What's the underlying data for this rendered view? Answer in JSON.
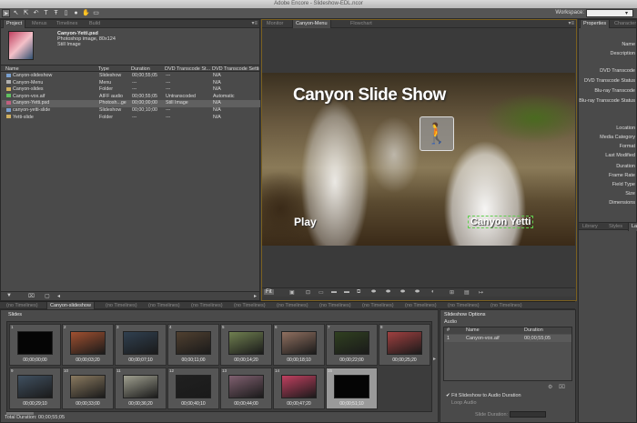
{
  "app": {
    "title": "Adobe Encore - Slideshow-EDL.ncor",
    "workspace_label": "Workspace:"
  },
  "tools": [
    "arrow-tool",
    "direct-select-tool",
    "move-tool",
    "rotate-tool",
    "text-tool",
    "vertical-text-tool",
    "edge-tool",
    "zoom-tool",
    "preview-tool"
  ],
  "project_panel": {
    "tabs": [
      "Project",
      "Menus",
      "Timelines",
      "Build"
    ],
    "selected_file": {
      "name": "Canyon-Yetti.psd",
      "type": "Photoshop image, 80x124",
      "kind": "Still Image"
    },
    "columns": [
      "Name",
      "Type",
      "Duration",
      "DVD Transcode St...",
      "DVD Transcode Settin"
    ],
    "items": [
      {
        "name": "Canyon-slideshow",
        "type": "Slideshow",
        "duration": "00;00;55;05",
        "status": "---",
        "settings": "N/A",
        "icon_color": "#7aa0d0",
        "selected": false
      },
      {
        "name": "Canyon-Menu",
        "type": "Menu",
        "duration": "---",
        "status": "---",
        "settings": "N/A",
        "icon_color": "#b0b0b0",
        "selected": false
      },
      {
        "name": "Canyon-slides",
        "type": "Folder",
        "duration": "---",
        "status": "---",
        "settings": "N/A",
        "icon_color": "#d0b060",
        "selected": false
      },
      {
        "name": "Canyon-vox.aif",
        "type": "AIFF audio",
        "duration": "00;00;55;05",
        "status": "Untranscoded",
        "settings": "Automatic",
        "icon_color": "#60c060",
        "selected": false
      },
      {
        "name": "Canyon-Yetti.psd",
        "type": "Photosh...ge",
        "duration": "00;00;00;00",
        "status": "Still Image",
        "settings": "N/A",
        "icon_color": "#c06080",
        "selected": true
      },
      {
        "name": "canyon-yetti-slide",
        "type": "Slideshow",
        "duration": "00;00;10;00",
        "status": "---",
        "settings": "N/A",
        "icon_color": "#7aa0d0",
        "selected": false
      },
      {
        "name": "Yetti-slide",
        "type": "Folder",
        "duration": "---",
        "status": "---",
        "settings": "N/A",
        "icon_color": "#d0b060",
        "selected": false
      }
    ]
  },
  "monitor_panel": {
    "tabs": [
      "Monitor",
      "Canyon-Menu",
      "Flowchart"
    ],
    "menu_title": "Canyon Slide Show",
    "play_button": "Play",
    "yetti_button": "Canyon Yetti",
    "zoom": "Fit"
  },
  "properties_panel": {
    "tabs": [
      "Properties",
      "Character"
    ],
    "labels": [
      "Name",
      "Description",
      "DVD Transcode",
      "DVD Transcode Status",
      "Blu-ray Transcode",
      "Blu-ray Transcode Status",
      "Location",
      "Media Category",
      "Format",
      "Last Modified",
      "Duration",
      "Frame Rate",
      "Field Type",
      "Size",
      "Dimensions"
    ],
    "bottom_tabs": [
      "Library",
      "Styles",
      "Layers"
    ]
  },
  "timeline_tabs": [
    "(no Timelines)",
    "Canyon-slideshow",
    "(no Timelines)",
    "(no Timelines)",
    "(no Timelines)",
    "(no Timelines)",
    "(no Timelines)",
    "(no Timelines)",
    "(no Timelines)",
    "(no Timelines)",
    "(no Timelines)",
    "(no Timelines)"
  ],
  "slides_panel": {
    "title": "Slides",
    "slides": [
      {
        "num": "1",
        "duration": "00;00;00;00",
        "color": "#050505"
      },
      {
        "num": "2",
        "duration": "00;00;03;20",
        "color": "#a05030"
      },
      {
        "num": "3",
        "duration": "00;00;07;10",
        "color": "#304050"
      },
      {
        "num": "4",
        "duration": "00;00;11;00",
        "color": "#504030"
      },
      {
        "num": "5",
        "duration": "00;00;14;20",
        "color": "#708050"
      },
      {
        "num": "6",
        "duration": "00;00;18;10",
        "color": "#907060"
      },
      {
        "num": "7",
        "duration": "00;00;22;00",
        "color": "#304020"
      },
      {
        "num": "8",
        "duration": "00;00;25;20",
        "color": "#a04040"
      },
      {
        "num": "9",
        "duration": "00;00;29;10",
        "color": "#405060"
      },
      {
        "num": "10",
        "duration": "00;00;33;00",
        "color": "#8a7a60"
      },
      {
        "num": "11",
        "duration": "00;00;36;20",
        "color": "#a0a090"
      },
      {
        "num": "12",
        "duration": "00;00;40;10",
        "color": "#202020"
      },
      {
        "num": "13",
        "duration": "00;00;44;00",
        "color": "#806070"
      },
      {
        "num": "14",
        "duration": "00;00;47;20",
        "color": "#c04060"
      },
      {
        "num": "15",
        "duration": "00;00;51;10",
        "color": "#050505"
      }
    ],
    "total_duration": "Total Duration: 00;00;55;05"
  },
  "slideshow_options": {
    "title": "Slideshow Options",
    "audio_label": "Audio",
    "col_hash": "#",
    "col_name": "Name",
    "col_duration": "Duration",
    "audio_row": {
      "num": "1",
      "name": "Canyon-vox.aif",
      "duration": "00;00;55;05"
    },
    "fit_label": "Fit Slideshow to Audio Duration",
    "loop_label": "Loop Audio",
    "slide_duration_label": "Slide Duration:"
  }
}
